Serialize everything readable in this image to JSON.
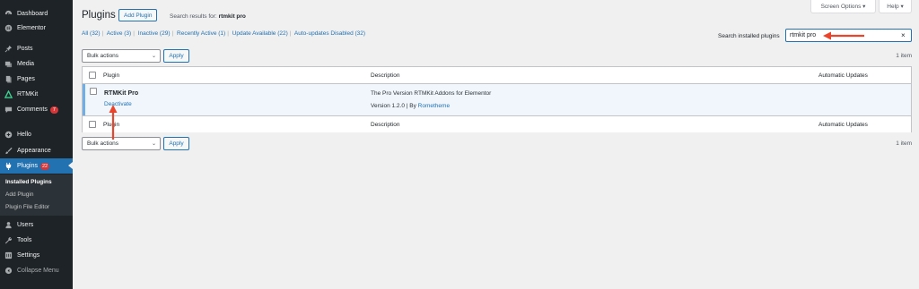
{
  "sidebar": {
    "items": [
      {
        "label": "Dashboard",
        "icon": "dashboard-icon"
      },
      {
        "label": "Elementor",
        "icon": "elementor-icon"
      },
      {
        "label": "Posts",
        "icon": "pin-icon"
      },
      {
        "label": "Media",
        "icon": "media-icon"
      },
      {
        "label": "Pages",
        "icon": "page-icon"
      },
      {
        "label": "RTMKit",
        "icon": "rtmkit-icon"
      },
      {
        "label": "Comments",
        "icon": "comment-icon",
        "badge": "7"
      },
      {
        "label": "Hello",
        "icon": "plus-circle-icon"
      },
      {
        "label": "Appearance",
        "icon": "brush-icon"
      },
      {
        "label": "Plugins",
        "icon": "plugin-icon",
        "badge": "22"
      },
      {
        "label": "Users",
        "icon": "user-icon"
      },
      {
        "label": "Tools",
        "icon": "wrench-icon"
      },
      {
        "label": "Settings",
        "icon": "settings-icon"
      },
      {
        "label": "Collapse Menu",
        "icon": "collapse-icon"
      }
    ],
    "submenu": [
      "Installed Plugins",
      "Add Plugin",
      "Plugin File Editor"
    ]
  },
  "top": {
    "screen_options": "Screen Options ▾",
    "help": "Help ▾"
  },
  "header": {
    "title": "Plugins",
    "add_plugin": "Add Plugin",
    "search_prefix": "Search results for: ",
    "search_term": "rtmkit pro"
  },
  "filters": [
    "All (32)",
    "Active (3)",
    "Inactive (29)",
    "Recently Active (1)",
    "Update Available (22)",
    "Auto-updates Disabled (32)"
  ],
  "search": {
    "label": "Search installed plugins",
    "value": "rtmkit pro",
    "clear": "×"
  },
  "bulk": {
    "label": "Bulk actions",
    "apply": "Apply",
    "count": "1 item"
  },
  "table": {
    "headers": {
      "plugin": "Plugin",
      "description": "Description",
      "auto": "Automatic Updates"
    },
    "row": {
      "name": "RTMKit Pro",
      "action": "Deactivate",
      "description": "The Pro Version RTMKit Addons for Elementor",
      "version": "Version 1.2.0",
      "by_prefix": " | By ",
      "author": "Rometheme"
    }
  },
  "colors": {
    "sidebar": "#1d2327",
    "accent": "#2271b1",
    "badge": "#d63638",
    "arrow": "#e8452c"
  }
}
